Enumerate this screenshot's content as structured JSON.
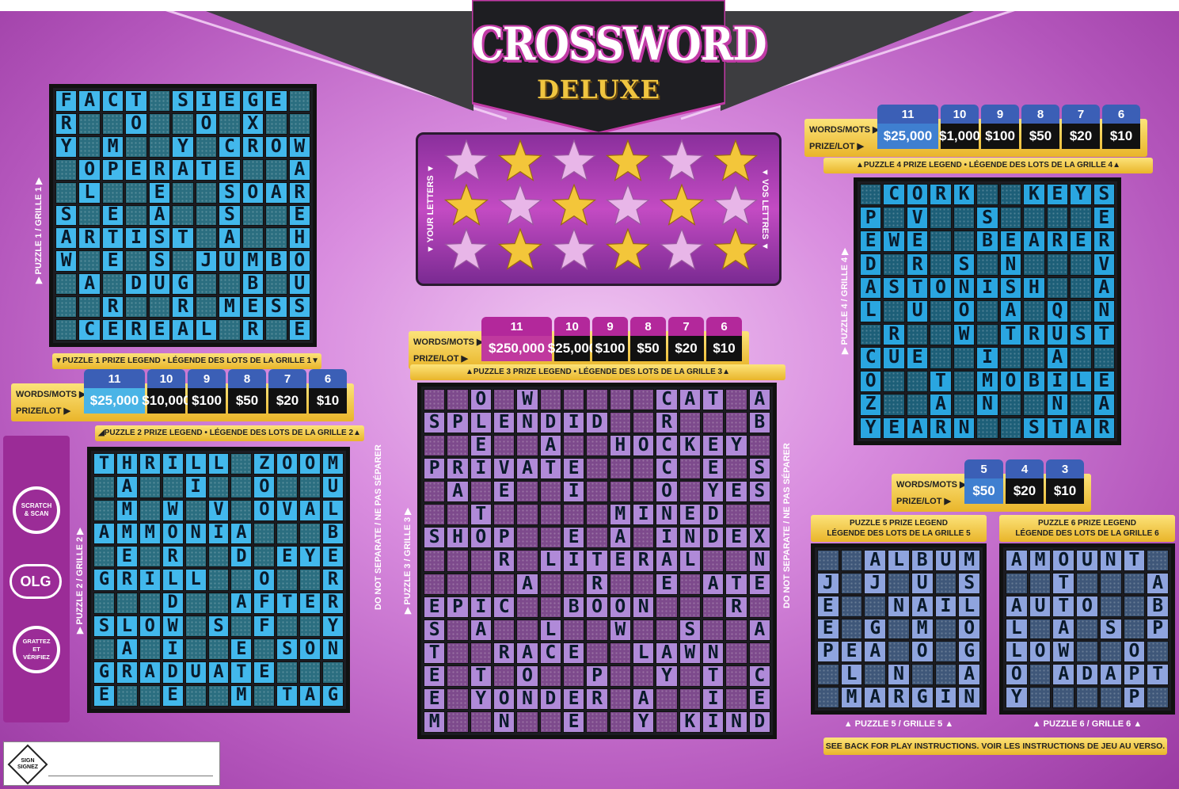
{
  "title": {
    "main": "CROSSWORD",
    "sub": "DELUXE"
  },
  "letters": {
    "label_en": "▼ YOUR LETTERS ▼",
    "label_fr": "▼ VOS LETTRES ▼"
  },
  "stars": [
    [
      "pink",
      "gold",
      "pink",
      "gold",
      "pink",
      "gold"
    ],
    [
      "gold",
      "pink",
      "gold",
      "pink",
      "gold",
      "pink"
    ],
    [
      "pink",
      "gold",
      "pink",
      "gold",
      "pink",
      "gold"
    ]
  ],
  "colors": {
    "blue": "#42b8ec",
    "teal": "#2b6e80",
    "purple": "#7d4a8c",
    "lavender": "#b08ad8",
    "steel": "#3f5779",
    "periw": "#8fa4de",
    "pink": "#c0399e",
    "gold": "#f3c63a"
  },
  "prize_tables": {
    "p1": {
      "words_label": "WORDS/MOTS ▶",
      "prize_label": "PRIZE/LOT ▶",
      "words": [
        "11",
        "10",
        "9",
        "8",
        "7",
        "6"
      ],
      "prizes": [
        "$25,000",
        "$10,000",
        "$100",
        "$50",
        "$20",
        "$10"
      ],
      "legend": "▼PUZZLE 1 PRIZE LEGEND • LÉGENDE DES LOTS DE LA GRILLE 1▼",
      "legend2": "◢PUZZLE 2 PRIZE LEGEND • LÉGENDE DES LOTS DE LA GRILLE 2▲"
    },
    "p3": {
      "words_label": "WORDS/MOTS ▶",
      "prize_label": "PRIZE/LOT ▶",
      "words": [
        "11",
        "10",
        "9",
        "8",
        "7",
        "6"
      ],
      "prizes": [
        "$250,000",
        "$25,000",
        "$100",
        "$50",
        "$20",
        "$10"
      ],
      "legend": "▲PUZZLE 3 PRIZE LEGEND • LÉGENDE DES LOTS DE LA GRILLE 3▲"
    },
    "p4": {
      "words_label": "WORDS/MOTS ▶",
      "prize_label": "PRIZE/LOT ▶",
      "words": [
        "11",
        "10",
        "9",
        "8",
        "7",
        "6"
      ],
      "prizes": [
        "$25,000",
        "$1,000",
        "$100",
        "$50",
        "$20",
        "$10"
      ],
      "legend": "▲PUZZLE 4 PRIZE LEGEND • LÉGENDE DES LOTS DE LA GRILLE 4▲"
    },
    "p56": {
      "words_label": "WORDS/MOTS ▶",
      "prize_label": "PRIZE/LOT ▶",
      "words": [
        "5",
        "4",
        "3"
      ],
      "prizes": [
        "$50",
        "$20",
        "$10"
      ],
      "legend5": "PUZZLE 5 PRIZE LEGEND\nLÉGENDE DES LOTS DE LA GRILLE 5",
      "legend6": "PUZZLE 6 PRIZE LEGEND\nLÉGENDE DES LOTS DE LA GRILLE 6"
    }
  },
  "puzzle_labels": {
    "p1": "▶ PUZZLE 1 / GRILLE 1 ▶",
    "p2": "▶ PUZZLE 2 / GRILLE 2 ▶",
    "p3": "▶ PUZZLE 3 / GRILLE 3 ▶",
    "p4": "▶ PUZZLE 4 / GRILLE 4 ▶",
    "p5": "▲ PUZZLE 5 / GRILLE 5 ▲",
    "p6": "▲ PUZZLE 6 / GRILLE 6 ▲"
  },
  "side_text": "DO NOT SEPARATE / NE PAS SÉPARER",
  "footer": "SEE BACK FOR PLAY INSTRUCTIONS. VOIR LES INSTRUCTIONS DE JEU AU VERSO.",
  "badges": {
    "scratch": "SCRATCH & SCAN",
    "olg": "OLG",
    "gratter": "GRATTEZ ET VÉRIFIEZ",
    "sign": "SIGN SIGNEZ"
  },
  "grids": {
    "g1": [
      "FACT.SIEGE.",
      "R..O..O.X..",
      "Y..M..Y.CROW",
      "..OPERATE..A",
      "..L..E..SOAR",
      "S..E..A..S..E",
      "ARTIST..A..H",
      "W..E..S.JUMBO",
      "..A..DUG..B.U",
      "..R..R.MESS",
      "..CEREAL..R.E"
    ],
    "g2": [
      "THRILL.ZOOM",
      "..A..I..O..U",
      "..M.W.V.OVAL",
      "AMMONIA....B",
      "..E..R..D.EYE",
      "GRILL....O..R",
      "....D..AFTER",
      "SLOW..S.F..Y",
      "..A..I..E.SON",
      "GRADUATE...",
      "E..E..M.TAG"
    ],
    "g3": [
      "..O.W.....CAT.A",
      "SPLENDID..R...B",
      "..E..A..HOCKEY",
      "PRIVATE....C.E.S",
      "..A..E..I...O.YES",
      "..T.....MINED",
      "SHOP...E..A.INDEX",
      "....R.LITERAL..N",
      "......A..R..E.ATE",
      "EPIC..BOON...R",
      "S..A..L..W..S..A",
      "T..RACE..LAWN",
      "E..T..O..P..Y.T.C",
      "E.YONDER.A..I.E",
      "M..N..E..Y.KIND"
    ],
    "g4": [
      "..CORK...KEYS",
      "P..V...S....E",
      "EWE..BEARER",
      "D..R..S..N...V",
      "ASTONISH...A",
      "L..U..O..A..Q.N",
      "..R..W.TRUST",
      "CUE...I..A..",
      "O....T.MOBILE",
      "Z....A..N..N.A",
      "YEARN....STAR"
    ],
    "g5": [
      "..ALBUM",
      "J..J..U..S",
      "E....NAIL",
      "E..G..M..O",
      "PEA..O..G",
      "..L..N..A",
      "..MARGIN"
    ],
    "g6": [
      "AMOUNT..",
      "....T...A",
      "AUTO....B",
      "L..A..S..P",
      "LOW...O.I",
      "O..ADAPT",
      "Y.......P.A"
    ]
  }
}
